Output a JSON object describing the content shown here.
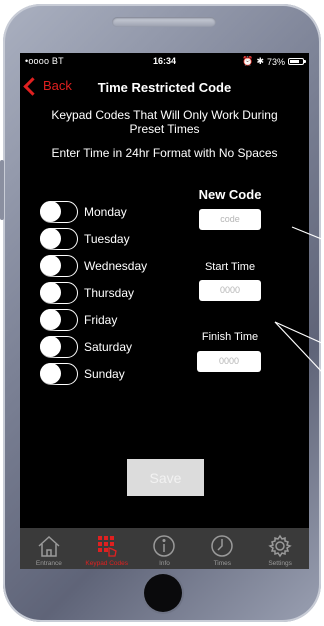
{
  "status": {
    "carrier": "•oooo BT",
    "time": "16:34",
    "battery": "73%",
    "battery_fraction": 0.73
  },
  "nav": {
    "back_label": "Back",
    "title": "Time Restricted Code"
  },
  "intro": {
    "line1a": "Keypad Codes That Will Only Work During",
    "line1b": "Preset Times",
    "line2": "Enter Time in 24hr Format with No Spaces"
  },
  "days": [
    "Monday",
    "Tuesday",
    "Wednesday",
    "Thursday",
    "Friday",
    "Saturday",
    "Sunday"
  ],
  "form": {
    "new_code_label": "New Code",
    "code_placeholder": "code",
    "start_label": "Start Time",
    "start_placeholder": "0000",
    "finish_label": "Finish Time",
    "finish_placeholder": "0000",
    "save_label": "Save"
  },
  "tabs": [
    {
      "label": "Entrance",
      "icon": "house-icon",
      "active": false
    },
    {
      "label": "Keypad Codes",
      "icon": "keypad-icon",
      "active": true
    },
    {
      "label": "Info",
      "icon": "info-icon",
      "active": false
    },
    {
      "label": "Times",
      "icon": "clock-icon",
      "active": false
    },
    {
      "label": "Settings",
      "icon": "gear-icon",
      "active": false
    }
  ],
  "colors": {
    "accent": "#e02020",
    "background": "#000000",
    "tabbar": "#3a3a3a"
  }
}
